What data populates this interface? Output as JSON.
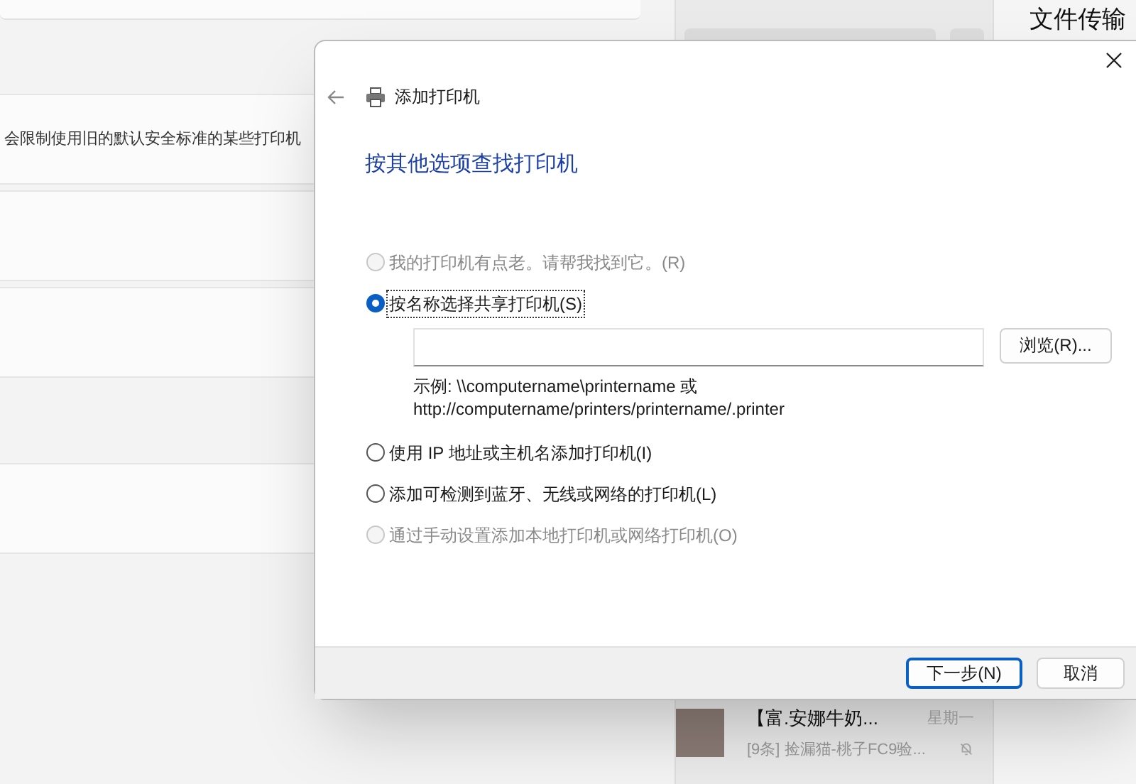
{
  "settings_window": {
    "description": "会限制使用旧的默认安全标准的某些打印机"
  },
  "chat_window": {
    "chats": [
      {
        "name": "【富.安娜牛奶...",
        "time": "星期一",
        "preview": "[9条] 捡漏猫-桃子FC9验...",
        "muted": true
      }
    ]
  },
  "chat_panel": {
    "title": "文件传输"
  },
  "dialog": {
    "title": "添加打印机",
    "heading": "按其他选项查找打印机",
    "options": [
      {
        "label": "我的打印机有点老。请帮我找到它。(R)",
        "selected": false,
        "disabled": true
      },
      {
        "label": "按名称选择共享打印机(S)",
        "selected": true,
        "disabled": false
      },
      {
        "label": "使用 IP 地址或主机名添加打印机(I)",
        "selected": false,
        "disabled": false
      },
      {
        "label": "添加可检测到蓝牙、无线或网络的打印机(L)",
        "selected": false,
        "disabled": false
      },
      {
        "label": "通过手动设置添加本地打印机或网络打印机(O)",
        "selected": false,
        "disabled": true
      }
    ],
    "browse_button": "浏览(R)...",
    "example_lines": [
      "示例: \\\\computername\\printername 或",
      "http://computername/printers/printername/.printer"
    ],
    "buttons": [
      {
        "label": "下一步(N)",
        "default": true
      },
      {
        "label": "取消",
        "default": false
      }
    ]
  }
}
